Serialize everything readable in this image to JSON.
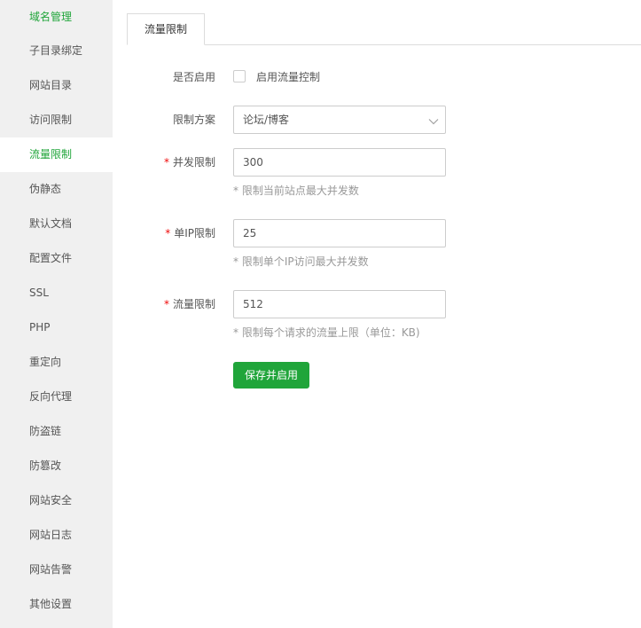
{
  "sidebar": {
    "items": [
      {
        "label": "域名管理"
      },
      {
        "label": "子目录绑定"
      },
      {
        "label": "网站目录"
      },
      {
        "label": "访问限制"
      },
      {
        "label": "流量限制"
      },
      {
        "label": "伪静态"
      },
      {
        "label": "默认文档"
      },
      {
        "label": "配置文件"
      },
      {
        "label": "SSL"
      },
      {
        "label": "PHP"
      },
      {
        "label": "重定向"
      },
      {
        "label": "反向代理"
      },
      {
        "label": "防盗链"
      },
      {
        "label": "防篡改"
      },
      {
        "label": "网站安全"
      },
      {
        "label": "网站日志"
      },
      {
        "label": "网站告警"
      },
      {
        "label": "其他设置"
      }
    ],
    "active_label": "流量限制"
  },
  "tabs": [
    {
      "label": "流量限制"
    }
  ],
  "form": {
    "enable": {
      "label": "是否启用",
      "checkbox_label": "启用流量控制",
      "checked": false
    },
    "scheme": {
      "label": "限制方案",
      "value": "论坛/博客"
    },
    "concurrent": {
      "required_mark": "*",
      "label": "并发限制",
      "value": "300",
      "help": "* 限制当前站点最大并发数"
    },
    "per_ip": {
      "required_mark": "*",
      "label": "单IP限制",
      "value": "25",
      "help": "* 限制单个IP访问最大并发数"
    },
    "rate": {
      "required_mark": "*",
      "label": "流量限制",
      "value": "512",
      "help": "* 限制每个请求的流量上限（单位：KB)"
    },
    "save_label": "保存并启用"
  },
  "colors": {
    "accent": "#20a53a",
    "required": "#ef0808",
    "sidebar_bg": "#f0f0f0"
  }
}
